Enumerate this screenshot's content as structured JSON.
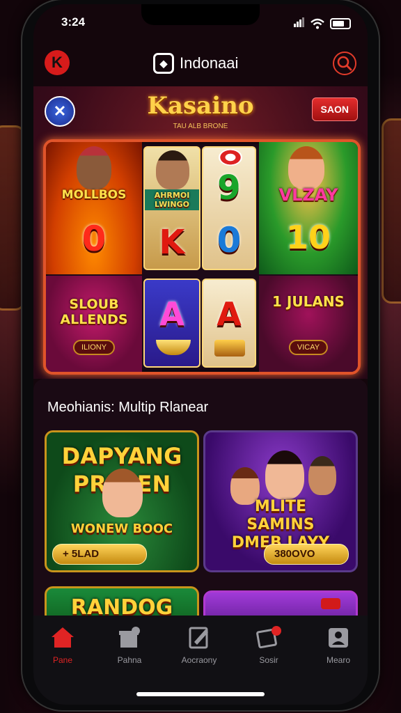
{
  "status": {
    "time": "3:24"
  },
  "header": {
    "brand": "Indonaai"
  },
  "hero": {
    "title": "Kasaino",
    "subtitle": "TAU ALB BRONE",
    "save_label": "SAON",
    "tiles": [
      {
        "name": "MOLLBOS",
        "value": "0"
      },
      {
        "name": "AHRMOI LWINGO",
        "value": "K"
      },
      {
        "name": "",
        "value": "9"
      },
      {
        "name": "",
        "value": "0"
      },
      {
        "name": "VLZAY",
        "value": "10"
      },
      {
        "name": "SLOUB ALLENDS",
        "label": "ILIONY"
      },
      {
        "name": "",
        "value": "A"
      },
      {
        "name": "",
        "value": "A"
      },
      {
        "name": "1 JULANS",
        "label": "VICAY"
      }
    ]
  },
  "feed": {
    "section_title": "Meohianis: Multip Rlanear",
    "cards": [
      {
        "title": "DAPYANG PRIMEN",
        "subtitle": "WONEW BOOC",
        "button": "+ 5LAD"
      },
      {
        "title": "MLITE SAMINS DMEB LAYY",
        "button": "380OVO"
      },
      {
        "title": "RANDOG"
      },
      {
        "title": ""
      }
    ]
  },
  "nav": [
    {
      "label": "Pane",
      "icon": "home-icon"
    },
    {
      "label": "Pahna",
      "icon": "gift-icon"
    },
    {
      "label": "Aocraony",
      "icon": "edit-icon"
    },
    {
      "label": "Sosir",
      "icon": "notification-icon"
    },
    {
      "label": "Mearo",
      "icon": "profile-icon"
    }
  ],
  "colors": {
    "accent": "#e02424",
    "gold": "#ffd23a",
    "frame": "#e0542a"
  }
}
